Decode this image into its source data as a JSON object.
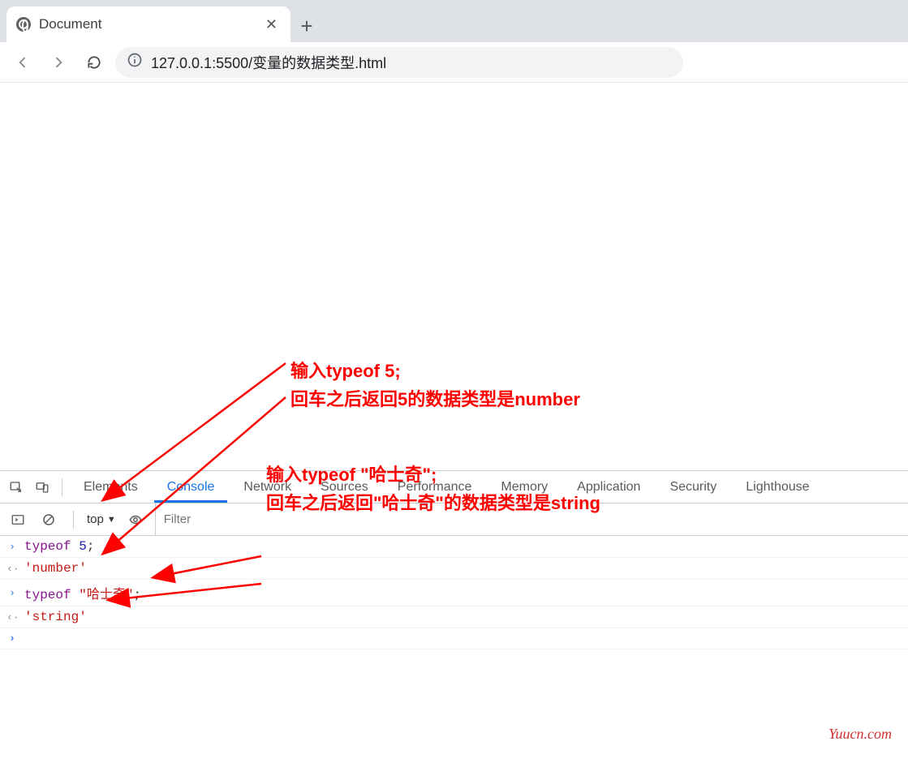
{
  "tab": {
    "title": "Document"
  },
  "omnibox": {
    "url": "127.0.0.1:5500/变量的数据类型.html"
  },
  "annotations": {
    "a1_line1": "输入typeof 5;",
    "a1_line2": "回车之后返回5的数据类型是number",
    "a2_line1": "输入typeof \"哈士奇\";",
    "a2_line2": "回车之后返回\"哈士奇\"的数据类型是string"
  },
  "devtools": {
    "tabs": [
      "Elements",
      "Console",
      "Network",
      "Sources",
      "Performance",
      "Memory",
      "Application",
      "Security",
      "Lighthouse"
    ],
    "active_tab": "Console",
    "context": "top",
    "filter_placeholder": "Filter",
    "console": {
      "row1": {
        "kw": "typeof",
        "val": "5",
        "tail": ";"
      },
      "row1_out": "'number'",
      "row2": {
        "kw": "typeof",
        "val": "\"哈士奇\"",
        "tail": ";"
      },
      "row2_out": "'string'"
    }
  },
  "watermark": "Yuucn.com"
}
